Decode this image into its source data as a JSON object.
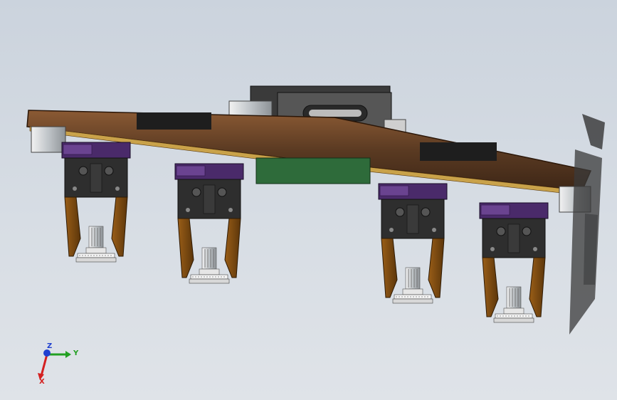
{
  "viewport": {
    "background_top": "#cbd3dd",
    "background_bottom": "#dfe3e8"
  },
  "model": {
    "colors": {
      "plate": "#5a3a22",
      "plate_edge": "#8b5a34",
      "cylinder": "#4a2a6a",
      "jaw": "#7a4a12",
      "pcb": "#2e6b3a",
      "metal": "#bfc4c8",
      "dark": "#2b2b2b"
    }
  },
  "triad": {
    "x_label": "X",
    "y_label": "Y",
    "z_label": "Z",
    "x_color": "#d42020",
    "y_color": "#22a022",
    "z_color": "#2040d0"
  }
}
